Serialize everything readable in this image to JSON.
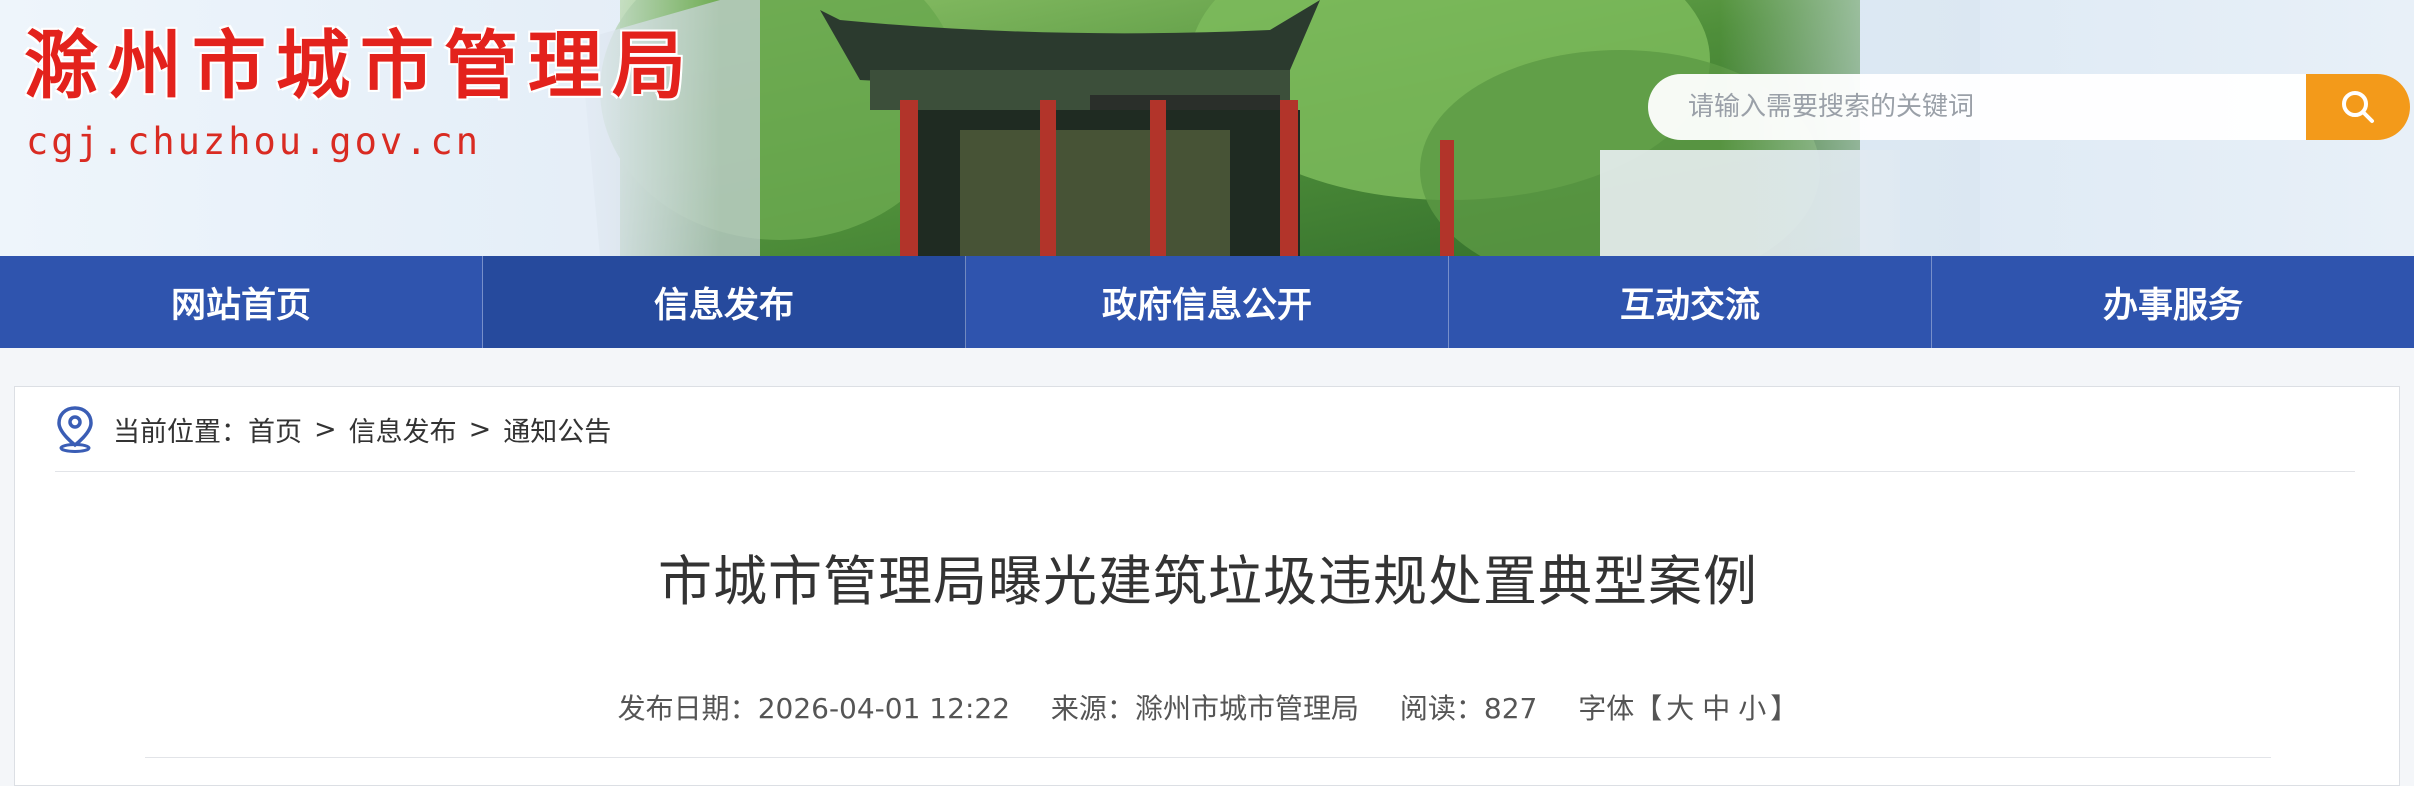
{
  "header": {
    "site_name": "滁州市城市管理局",
    "site_domain": "cgj.chuzhou.gov.cn",
    "search": {
      "placeholder": "请输入需要搜索的关键词",
      "button_icon": "search-icon",
      "button_color": "#f39a1a"
    },
    "title_color": "#e3221c"
  },
  "nav": {
    "background": "#2f54ae",
    "items": [
      {
        "label": "网站首页"
      },
      {
        "label": "信息发布",
        "active": true
      },
      {
        "label": "政府信息公开"
      },
      {
        "label": "互动交流"
      },
      {
        "label": "办事服务"
      }
    ]
  },
  "breadcrumb": {
    "icon": "location-pin-icon",
    "prefix": "当前位置：",
    "items": [
      "首页",
      "信息发布",
      "通知公告"
    ],
    "separator": ">"
  },
  "article": {
    "title": "市城市管理局曝光建筑垃圾违规处置典型案例",
    "date_label": "发布日期：",
    "date_value": "2026-04-01 12:22",
    "source_label": "来源：",
    "source_value": "滁州市城市管理局",
    "reads_label": "阅读：",
    "reads_value": "827",
    "font_label": "字体【",
    "font_large": "大",
    "font_medium": "中",
    "font_small": "小",
    "font_close": "】"
  }
}
